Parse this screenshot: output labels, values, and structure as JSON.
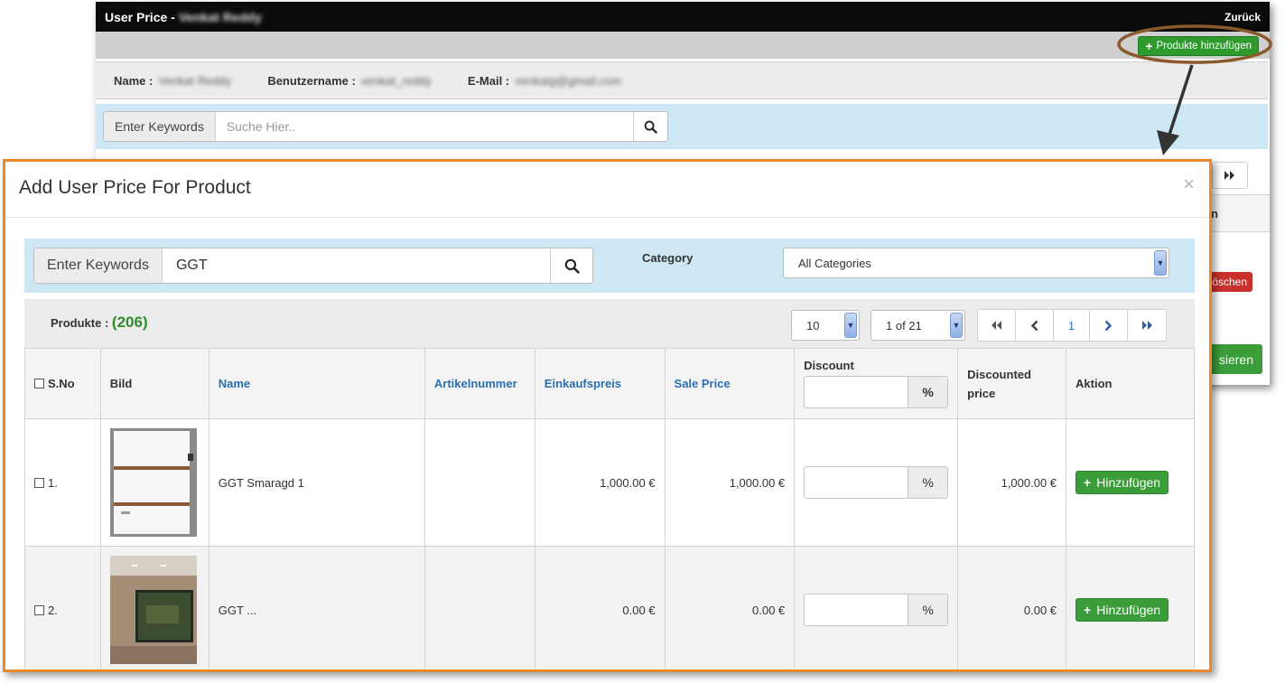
{
  "background_window": {
    "title_prefix": "User Price -",
    "title_name": "Venkat Reddy",
    "back_label": "Zurück",
    "add_products_label": "Produkte hinzufügen",
    "user_info": {
      "name_label": "Name :",
      "name_value": "Venkat Reddy",
      "username_label": "Benutzername :",
      "username_value": "venkat_reddy",
      "email_label": "E-Mail :",
      "email_value": "venkatg@gmail.com"
    },
    "search": {
      "addon_label": "Enter Keywords",
      "placeholder": "Suche Hier.."
    },
    "partial_column_header": "n",
    "partial_delete_label": "öschen",
    "partial_action_label": "sieren"
  },
  "modal": {
    "title": "Add User Price For Product",
    "close_symbol": "×",
    "search": {
      "addon_label": "Enter Keywords",
      "value": "GGT"
    },
    "category_label": "Category",
    "category_value": "All Categories",
    "products_label": "Produkte :",
    "products_count": "(206)",
    "page_size": "10",
    "page_selector": "1 of 21",
    "current_page": "1",
    "table": {
      "headers": {
        "sno": "S.No",
        "image": "Bild",
        "name": "Name",
        "article": "Artikelnummer",
        "purchase": "Einkaufspreis",
        "sale": "Sale Price",
        "discount": "Discount",
        "discounted": "Discounted price",
        "action": "Aktion"
      },
      "percent_symbol": "%",
      "action_label": "Hinzufügen",
      "rows": [
        {
          "sno": "1.",
          "name": "GGT Smaragd 1",
          "article": "",
          "purchase": "1,000.00 €",
          "sale": "1,000.00 €",
          "discounted": "1,000.00 €"
        },
        {
          "sno": "2.",
          "name": "GGT ...",
          "article": "",
          "purchase": "0.00 €",
          "sale": "0.00 €",
          "discounted": "0.00 €"
        }
      ]
    }
  },
  "colors": {
    "modal_border": "#e8892b",
    "annotation_ellipse": "#8b5a2b",
    "success_green": "#3a9d3a",
    "link_blue": "#2a6faf",
    "band_blue": "#cde8f4",
    "danger_red": "#c9302c"
  }
}
